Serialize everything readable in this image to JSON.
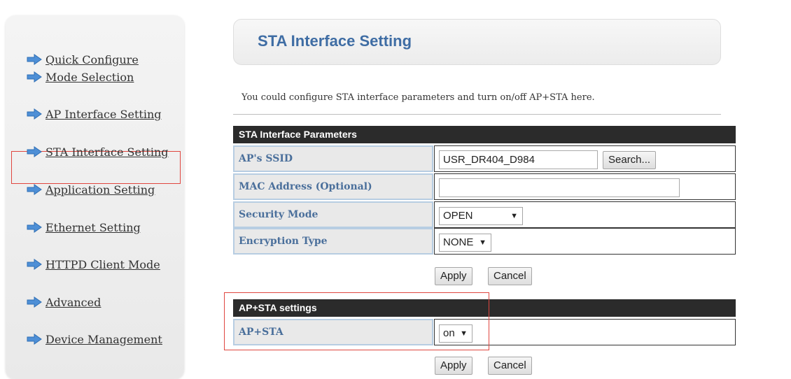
{
  "sidebar": {
    "items": [
      {
        "label": "Quick Configure"
      },
      {
        "label": "Mode Selection"
      },
      {
        "label": "AP Interface Setting"
      },
      {
        "label": "STA Interface Setting"
      },
      {
        "label": "Application Setting"
      },
      {
        "label": "Ethernet Setting"
      },
      {
        "label": "HTTPD Client Mode"
      },
      {
        "label": "Advanced"
      },
      {
        "label": "Device Management"
      }
    ],
    "active": "STA Interface Setting"
  },
  "page": {
    "title": "STA Interface Setting",
    "description": "You could configure STA interface parameters and turn on/off AP+STA here."
  },
  "sta_params": {
    "header": "STA Interface Parameters",
    "ssid_label": "AP's SSID",
    "ssid_value": "USR_DR404_D984",
    "search_button": "Search...",
    "mac_label": "MAC Address (Optional)",
    "mac_value": "",
    "security_label": "Security Mode",
    "security_value": "OPEN",
    "encryption_label": "Encryption Type",
    "encryption_value": "NONE",
    "apply_button": "Apply",
    "cancel_button": "Cancel"
  },
  "apsta": {
    "header": "AP+STA settings",
    "label": "AP+STA",
    "value": "on",
    "apply_button": "Apply",
    "cancel_button": "Cancel"
  },
  "colors": {
    "title": "#3f6da4",
    "label_text": "#4a6f9b",
    "section_header_bg": "#2b2b2b",
    "highlight_border": "#e0463f",
    "arrow_icon": "#4e8fd6"
  }
}
